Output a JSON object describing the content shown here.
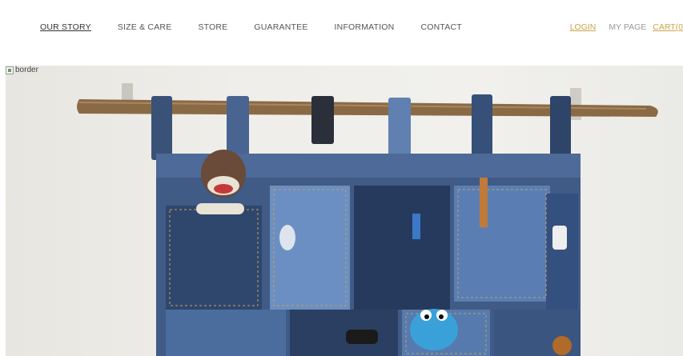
{
  "nav": {
    "items": [
      {
        "label": "OUR STORY",
        "active": true
      },
      {
        "label": "SIZE & CARE",
        "active": false
      },
      {
        "label": "STORE",
        "active": false
      },
      {
        "label": "GUARANTEE",
        "active": false
      },
      {
        "label": "INFORMATION",
        "active": false
      },
      {
        "label": "CONTACT",
        "active": false
      }
    ]
  },
  "account": {
    "login": "LOGIN",
    "mypage": "MY PAGE",
    "cart": "CART(0"
  },
  "hero": {
    "alt_text": "border",
    "subject": "denim pocket wall organizer hanging on wooden rod"
  },
  "colors": {
    "accent_gold": "#c9a64a",
    "nav_text": "#555555",
    "muted": "#999999"
  }
}
